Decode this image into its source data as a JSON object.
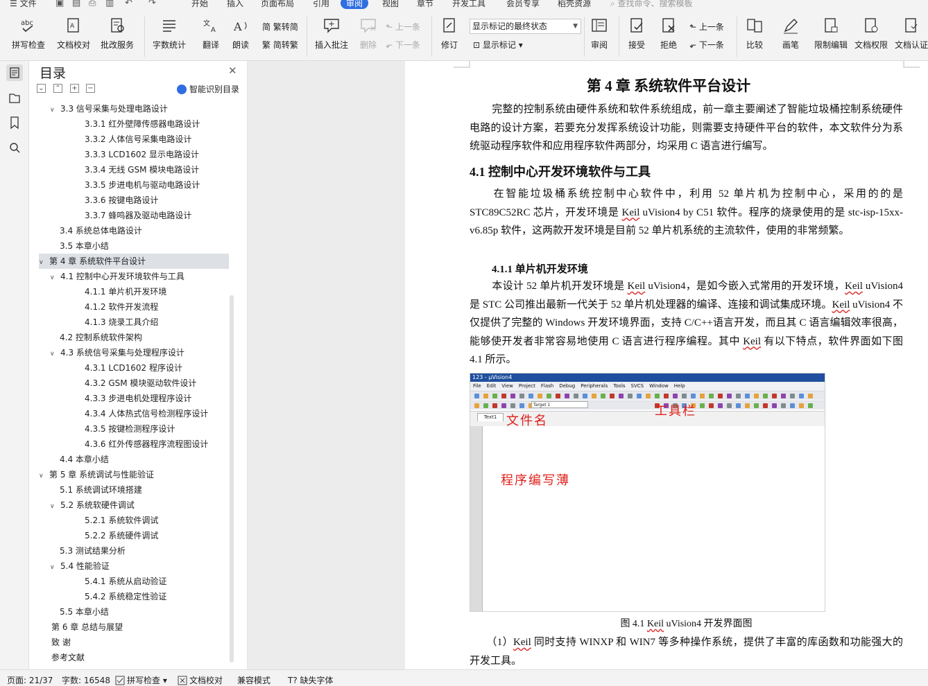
{
  "menubar": {
    "file_label": "文件",
    "tabs": [
      "开始",
      "插入",
      "页面布局",
      "引用",
      "审阅",
      "视图",
      "章节",
      "开发工具",
      "会员专享",
      "稻壳资源"
    ],
    "active_tab": "审阅",
    "search_placeholder": "查找命令、搜索模板"
  },
  "ribbon": {
    "spell_check": "拼写检查",
    "doc_proof": "文档校对",
    "batch_service": "批改服务",
    "word_count": "字数统计",
    "translate": "翻译",
    "read_aloud": "朗读",
    "trad_to_simp": "繁转简",
    "simp_to_trad": "简转繁",
    "insert_comment": "插入批注",
    "delete": "删除",
    "prev_comment": "上一条",
    "next_comment": "下一条",
    "track_changes": "修订",
    "show_markup_state": "显示标记的最终状态",
    "show_markup": "显示标记",
    "review": "审阅",
    "accept": "接受",
    "reject": "拒绝",
    "prev_change": "上一条",
    "next_change": "下一条",
    "compare": "比较",
    "pen": "画笔",
    "restrict_edit": "限制编辑",
    "doc_permission": "文档权限",
    "doc_cert": "文档认证"
  },
  "toc": {
    "title": "目录",
    "smart_label": "智能识别目录",
    "items": [
      {
        "text": "3.3  信号采集与处理电路设计",
        "chev": "v"
      },
      {
        "text": "3.3.1  红外壁障传感器电路设计",
        "chev": ""
      },
      {
        "text": "3.3.2  人体信号采集电路设计",
        "chev": ""
      },
      {
        "text": "3.3.3 LCD1602 显示电路设计",
        "chev": ""
      },
      {
        "text": "3.3.4  无线 GSM 模块电路设计",
        "chev": ""
      },
      {
        "text": "3.3.5  步进电机与驱动电路设计",
        "chev": ""
      },
      {
        "text": "3.3.6  按键电路设计",
        "chev": ""
      },
      {
        "text": "3.3.7  蜂鸣器及驱动电路设计",
        "chev": ""
      },
      {
        "text": "3.4  系统总体电路设计",
        "chev": ""
      },
      {
        "text": "3.5  本章小结",
        "chev": ""
      },
      {
        "text": "第 4 章  系统软件平台设计",
        "chev": "v"
      },
      {
        "text": "4.1  控制中心开发环境软件与工具",
        "chev": "v"
      },
      {
        "text": "4.1.1  单片机开发环境",
        "chev": ""
      },
      {
        "text": "4.1.2  软件开发流程",
        "chev": ""
      },
      {
        "text": "4.1.3  烧录工具介绍",
        "chev": ""
      },
      {
        "text": "4.2  控制系统软件架构",
        "chev": ""
      },
      {
        "text": "4.3  系统信号采集与处理程序设计",
        "chev": "v"
      },
      {
        "text": "4.3.1 LCD1602 程序设计",
        "chev": ""
      },
      {
        "text": "4.3.2 GSM 模块驱动软件设计",
        "chev": ""
      },
      {
        "text": "4.3.3  步进电机处理程序设计",
        "chev": ""
      },
      {
        "text": "4.3.4  人体热式信号检测程序设计",
        "chev": ""
      },
      {
        "text": "4.3.5  按键检测程序设计",
        "chev": ""
      },
      {
        "text": "4.3.6  红外传感器程序流程图设计",
        "chev": ""
      },
      {
        "text": "4.4  本章小结",
        "chev": ""
      },
      {
        "text": "第 5 章  系统调试与性能验证",
        "chev": "v"
      },
      {
        "text": "5.1  系统调试环境搭建",
        "chev": ""
      },
      {
        "text": "5.2  系统软硬件调试",
        "chev": "v"
      },
      {
        "text": "5.2.1  系统软件调试",
        "chev": ""
      },
      {
        "text": "5.2.2  系统硬件调试",
        "chev": ""
      },
      {
        "text": "5.3  测试结果分析",
        "chev": ""
      },
      {
        "text": "5.4  性能验证",
        "chev": "v"
      },
      {
        "text": "5.4.1  系统从启动验证",
        "chev": ""
      },
      {
        "text": "5.4.2  系统稳定性验证",
        "chev": ""
      },
      {
        "text": "5.5  本章小结",
        "chev": ""
      },
      {
        "text": "第 6 章  总结与展望",
        "chev": ""
      },
      {
        "text": "致    谢",
        "chev": ""
      },
      {
        "text": "参考文献",
        "chev": ""
      }
    ],
    "selected_index": 10
  },
  "document": {
    "chapter_title": "第 4 章  系统软件平台设计",
    "intro": "完整的控制系统由硬件系统和软件系统组成，前一章主要阐述了智能垃圾桶控制系统硬件电路的设计方案，若要充分发挥系统设计功能，则需要支持硬件平台的软件，本文软件分为系统驱动程序软件和应用程序软件两部分，均采用 C 语言进行编写。",
    "h41": "4.1  控制中心开发环境软件与工具",
    "p41_a": "在智能垃圾桶系统控制中心软件中，利用 52 单片机为控制中心，采用的的是 STC89C52RC 芯片，开发环境是 ",
    "p41_keil": "Keil",
    "p41_b": " uVision4 by C51 软件。程序的烧录使用的是 stc-isp-15xx-v6.85p 软件，这两款开发环境是目前 52 单片机系统的主流软件，使用的非常频繁。",
    "h411": "4.1.1  单片机开发环境",
    "p411_a": "本设计 52 单片机开发环境是 ",
    "p411_k1": "Keil",
    "p411_b": " uVision4，是如今嵌入式常用的开发环境，",
    "p411_k2": "Keil",
    "p411_c": " uVision4 是 STC 公司推出最新一代关于 52 单片机处理器的编译、连接和调试集成环境。",
    "p411_k3": "Keil",
    "p411_d": " uVision4 不仅提供了完整的 Windows 开发环境界面，支持 C/C++语言开发，而且其 C 语言编辑效率很高，能够使开发者非常容易地使用 C 语言进行程序编程。其中 ",
    "p411_k4": "Keil",
    "p411_e": " 有以下特点，软件界面如下图 4.1 所示。",
    "figure": {
      "window_title": "123 - µVision4",
      "menu_items": [
        "File",
        "Edit",
        "View",
        "Project",
        "Flash",
        "Debug",
        "Peripherals",
        "Tools",
        "SVCS",
        "Window",
        "Help"
      ],
      "target": "Target 1",
      "tab": "Text1",
      "note_filename": "文件名",
      "note_toolbar": "工具栏",
      "note_editor": "程序编写薄"
    },
    "caption_a": "图 4.1 ",
    "caption_keil": "Keil",
    "caption_b": " uVision4 开发界面图",
    "p1_a": "（1）",
    "p1_keil": "Keil",
    "p1_b": " 同时支持 WINXP 和 WIN7 等多种操作系统，提供了丰富的库函数和功能强大的开发工具。"
  },
  "statusbar": {
    "page": "页面: 21/37",
    "words": "字数: 16548",
    "spell": "拼写检查",
    "proof": "文档校对",
    "compat": "兼容模式",
    "missing_font": "缺失字体"
  },
  "colors": {
    "accent": "#2f6de1",
    "red_note": "#e0201b"
  }
}
